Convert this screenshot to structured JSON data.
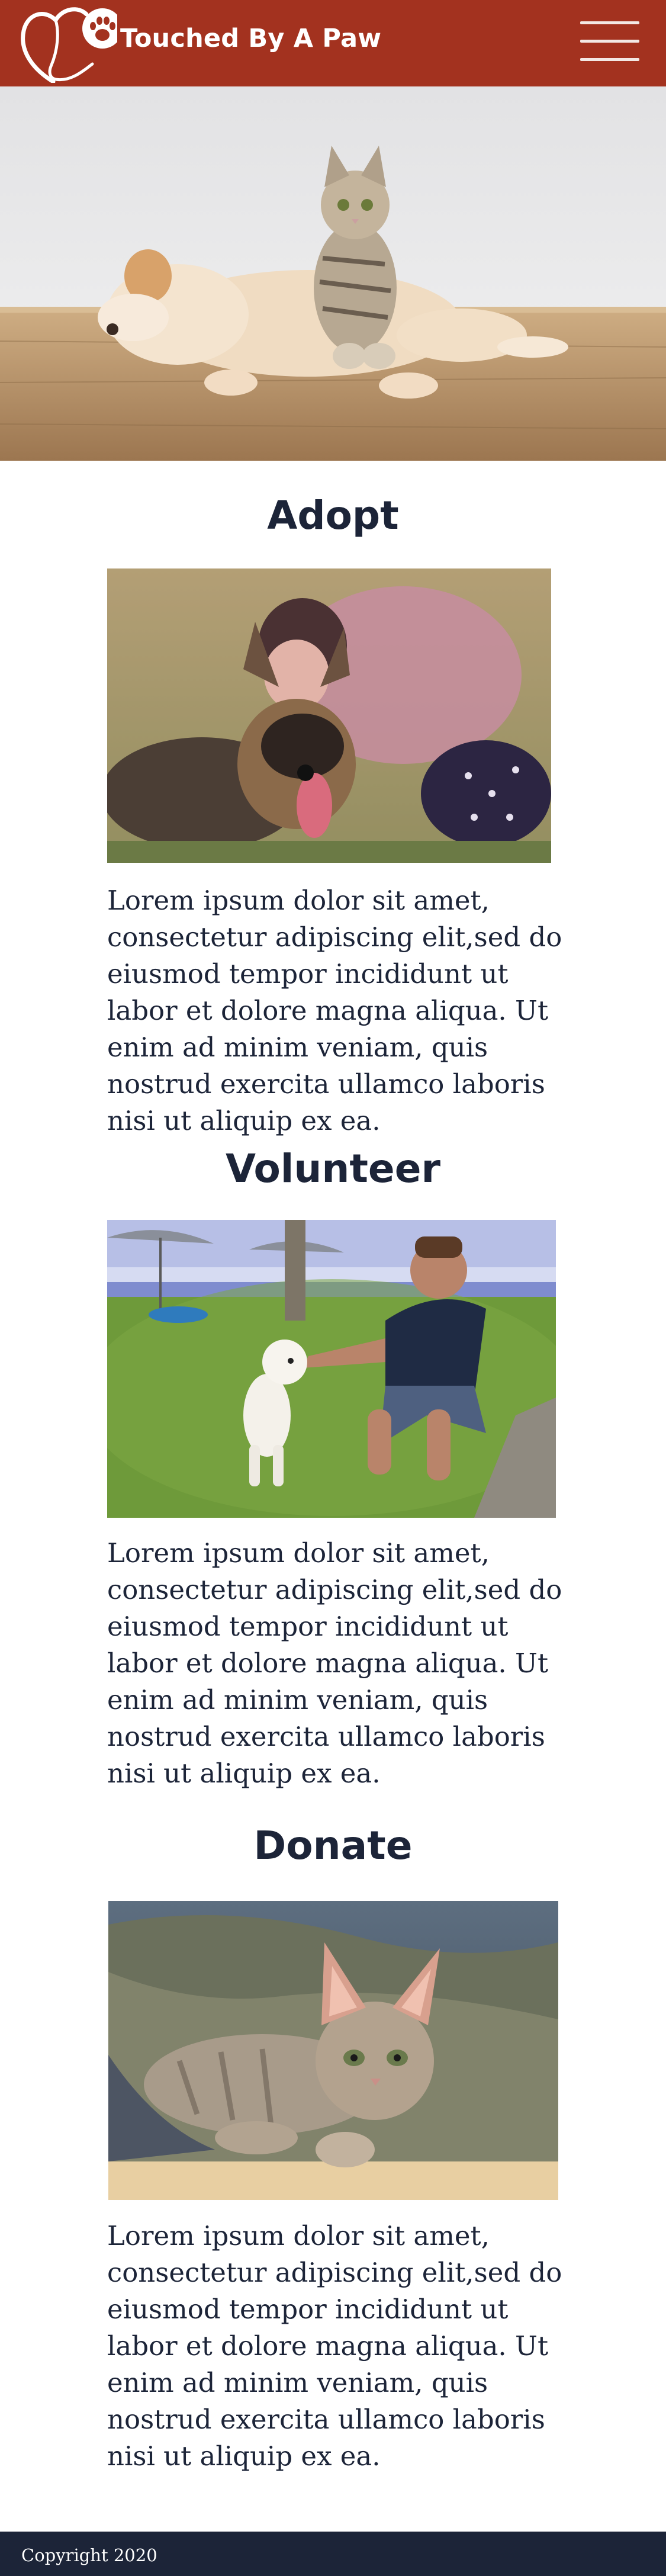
{
  "header": {
    "brand": "Touched By A Paw",
    "logo_icon": "heart-paw-logo-icon",
    "menu_icon": "hamburger-menu-icon",
    "background_color": "#a3321f"
  },
  "hero": {
    "image": "puppy-and-kitten-photo"
  },
  "sections": [
    {
      "title": "Adopt",
      "image": "girl-hugging-german-shepherd-photo",
      "text": "Lorem ipsum dolor sit amet, consectetur adipiscing elit,sed do eiusmod tempor incididunt ut labor et dolore magna aliqua. Ut enim ad minim veniam, quis nostrud exercita ullamco laboris nisi ut aliquip ex ea."
    },
    {
      "title": "Volunteer",
      "image": "man-with-white-puppy-photo",
      "text": "Lorem ipsum dolor sit amet, consectetur adipiscing elit,sed do eiusmod tempor incididunt ut labor et dolore magna aliqua. Ut enim ad minim veniam, quis nostrud exercita ullamco laboris nisi ut aliquip ex ea."
    },
    {
      "title": "Donate",
      "image": "kitten-on-cushion-photo",
      "text": "Lorem ipsum dolor sit amet, consectetur adipiscing elit,sed do eiusmod tempor incididunt ut labor et dolore magna aliqua. Ut enim ad minim veniam, quis nostrud exercita ullamco laboris nisi ut aliquip ex ea."
    }
  ],
  "footer": {
    "copyright": "Copyright 2020",
    "background_color": "#1c2438"
  }
}
